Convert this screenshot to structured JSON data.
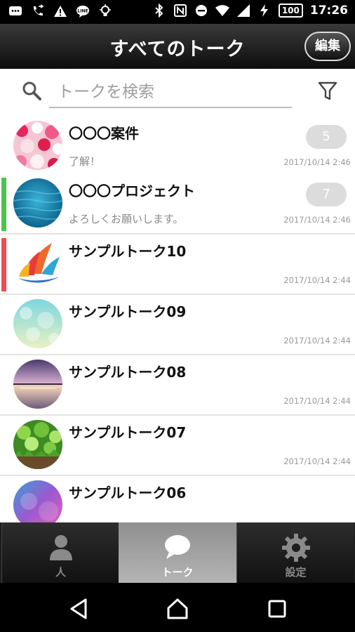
{
  "status_bar": {
    "time": "17:26",
    "battery": "100",
    "left_icons": [
      "message-icon",
      "call-forward-icon",
      "warning-icon",
      "line-icon",
      "bulb-icon"
    ],
    "right_icons": [
      "bluetooth-icon",
      "nfc-icon",
      "do-not-disturb-icon",
      "wifi-icon",
      "signal-icon",
      "charging-icon"
    ]
  },
  "header": {
    "title": "すべてのトーク",
    "edit_label": "編集"
  },
  "search": {
    "placeholder": "トークを検索"
  },
  "talks": [
    {
      "name": "〇〇〇案件",
      "message": "了解！",
      "time": "2017/10/14 2:46",
      "unread": "5",
      "marker": "",
      "avatar": "hearts"
    },
    {
      "name": "〇〇〇プロジェクト",
      "message": "よろしくお願いします。",
      "time": "2017/10/14 2:46",
      "unread": "7",
      "marker": "#4cc24a",
      "avatar": "water"
    },
    {
      "name": "サンプルトーク10",
      "message": "",
      "time": "2017/10/14 2:44",
      "unread": "",
      "marker": "#ef4a55",
      "avatar": "sails"
    },
    {
      "name": "サンプルトーク09",
      "message": "",
      "time": "2017/10/14 2:44",
      "unread": "",
      "marker": "",
      "avatar": "bokeh"
    },
    {
      "name": "サンプルトーク08",
      "message": "",
      "time": "2017/10/14 2:44",
      "unread": "",
      "marker": "",
      "avatar": "sunset"
    },
    {
      "name": "サンプルトーク07",
      "message": "",
      "time": "2017/10/14 2:44",
      "unread": "",
      "marker": "",
      "avatar": "grass"
    },
    {
      "name": "サンプルトーク06",
      "message": "",
      "time": "",
      "unread": "",
      "marker": "",
      "avatar": "galaxy"
    }
  ],
  "tabs": [
    {
      "label": "人",
      "icon": "person-icon",
      "active": false
    },
    {
      "label": "トーク",
      "icon": "chat-bubble-icon",
      "active": true
    },
    {
      "label": "設定",
      "icon": "gear-icon",
      "active": false
    }
  ],
  "nav": [
    "back-icon",
    "home-icon",
    "recents-icon"
  ],
  "colors": {
    "green_marker": "#4cc24a",
    "red_marker": "#ef4a55",
    "badge": "#dcdcdc"
  }
}
